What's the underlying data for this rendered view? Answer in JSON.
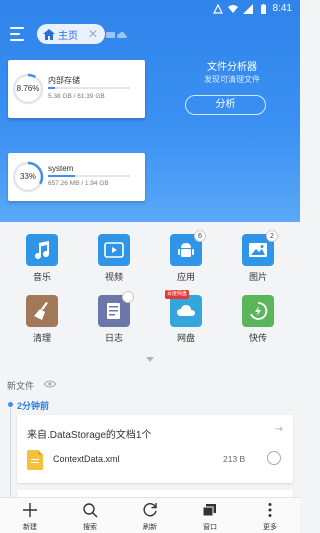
{
  "status_bar": {
    "time": "8:41"
  },
  "tab": {
    "label": "主页"
  },
  "storage": [
    {
      "percent_label": "8.76%",
      "percent": 8.76,
      "title": "内部存储",
      "usage": "5.38 GB / 61.39 GB"
    },
    {
      "percent_label": "33%",
      "percent": 33,
      "title": "system",
      "usage": "657.26 MB / 1.94 GB"
    }
  ],
  "analyzer": {
    "title": "文件分析器",
    "subtitle": "发现可清理文件",
    "button": "分析"
  },
  "categories": [
    {
      "label": "音乐",
      "icon": "music-icon",
      "color": "#2f95e8"
    },
    {
      "label": "视频",
      "icon": "video-icon",
      "color": "#2f95e8"
    },
    {
      "label": "应用",
      "icon": "android-icon",
      "color": "#2f95e8",
      "badge": "6"
    },
    {
      "label": "图片",
      "icon": "picture-icon",
      "color": "#2f95e8",
      "badge": "2"
    },
    {
      "label": "清理",
      "icon": "broom-icon",
      "color": "#a0785a"
    },
    {
      "label": "日志",
      "icon": "log-icon",
      "color": "#6a77a8"
    },
    {
      "label": "网盘",
      "icon": "cloud-icon",
      "color": "#35a6dc",
      "tag": "百度网盘"
    },
    {
      "label": "快传",
      "icon": "transfer-icon",
      "color": "#5bb55b"
    }
  ],
  "new_files": {
    "label": "新文件",
    "time_group": "2分钟前",
    "card_title": "来自.DataStorage的文档1个",
    "file_name": "ContextData.xml",
    "file_size": "213 B"
  },
  "toolbar": [
    {
      "label": "新建",
      "icon": "plus-icon"
    },
    {
      "label": "搜索",
      "icon": "search-icon"
    },
    {
      "label": "刷新",
      "icon": "refresh-icon"
    },
    {
      "label": "窗口",
      "icon": "windows-icon"
    },
    {
      "label": "更多",
      "icon": "more-icon"
    }
  ]
}
